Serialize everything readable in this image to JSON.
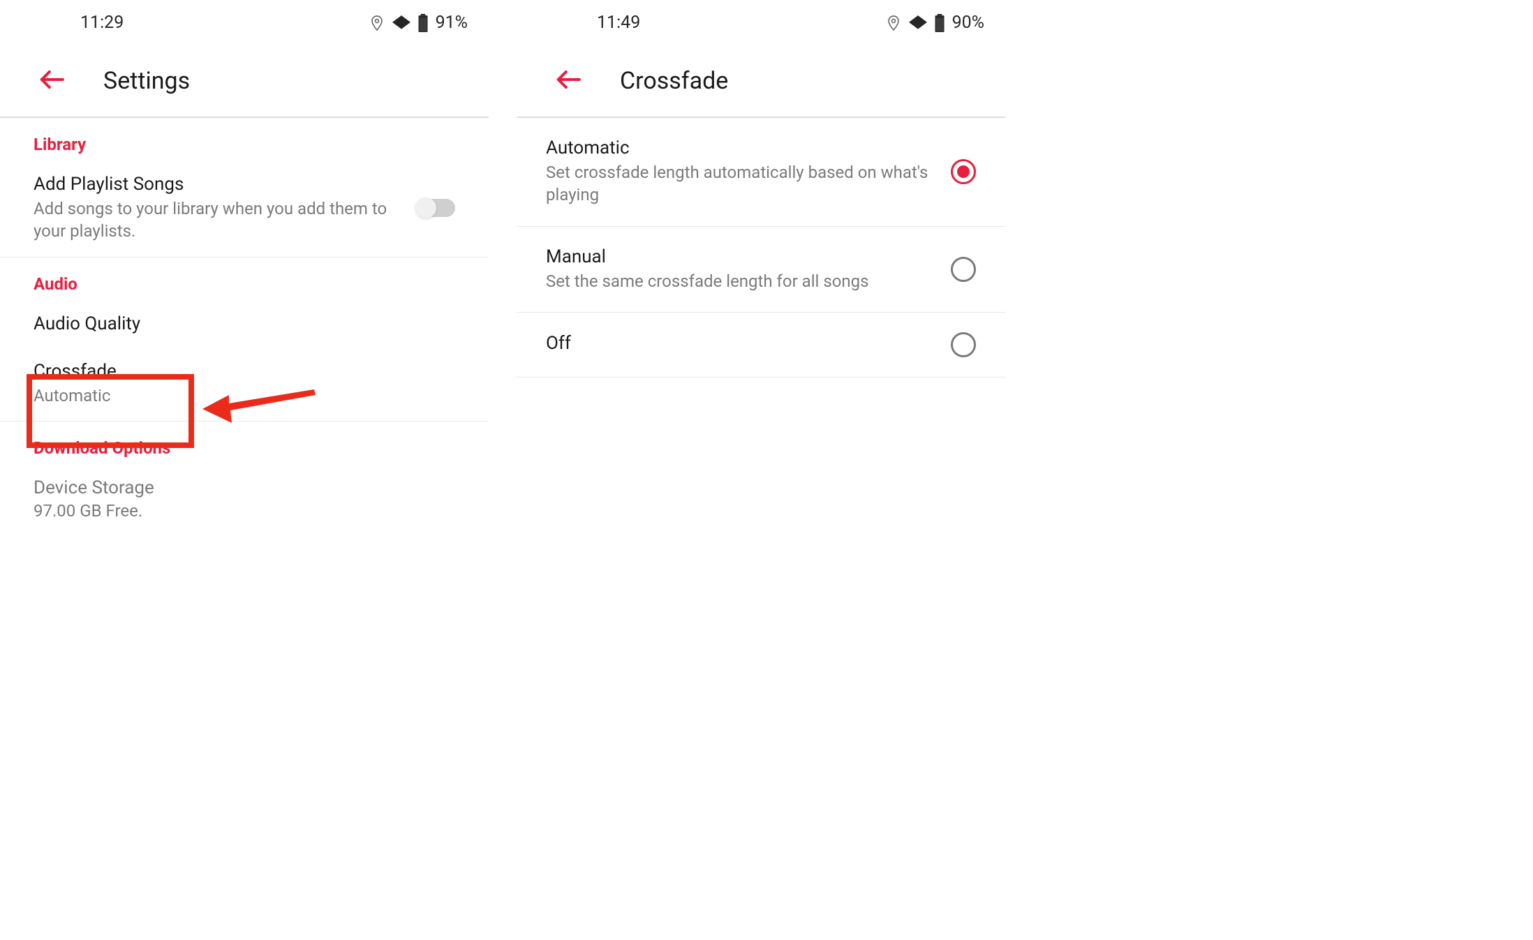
{
  "left_screen": {
    "status": {
      "time": "11:29",
      "battery": "91%"
    },
    "title": "Settings",
    "sections": {
      "library": {
        "header": "Library",
        "add_playlist": {
          "title": "Add Playlist Songs",
          "subtitle": "Add songs to your library when you add them to your playlists."
        }
      },
      "audio": {
        "header": "Audio",
        "audio_quality": {
          "title": "Audio Quality"
        },
        "crossfade": {
          "title": "Crossfade",
          "subtitle": "Automatic"
        }
      },
      "download": {
        "header": "Download Options",
        "storage": {
          "title": "Device Storage",
          "subtitle": "97.00 GB Free."
        }
      }
    }
  },
  "right_screen": {
    "status": {
      "time": "11:49",
      "battery": "90%"
    },
    "title": "Crossfade",
    "options": {
      "automatic": {
        "title": "Automatic",
        "subtitle": "Set crossfade length automatically based on what's playing"
      },
      "manual": {
        "title": "Manual",
        "subtitle": "Set the same crossfade length for all songs"
      },
      "off": {
        "title": "Off"
      }
    }
  }
}
